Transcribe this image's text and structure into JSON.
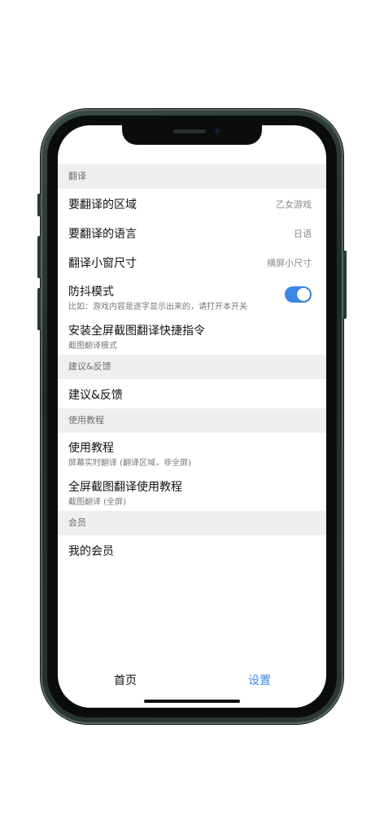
{
  "sections": {
    "translate": {
      "header": "翻译",
      "region": {
        "title": "要翻译的区域",
        "value": "乙女游戏"
      },
      "language": {
        "title": "要翻译的语言",
        "value": "日语"
      },
      "window_size": {
        "title": "翻译小窗尺寸",
        "value": "横屏小尺寸"
      },
      "anti_shake": {
        "title": "防抖模式",
        "subtitle": "比如：游戏内容是逐字显示出来的，请打开本开关",
        "enabled": true
      },
      "shortcut": {
        "title": "安装全屏截图翻译快捷指令",
        "subtitle": "截图翻译模式"
      }
    },
    "feedback": {
      "header": "建议&反馈",
      "item": {
        "title": "建议&反馈"
      }
    },
    "tutorial": {
      "header": "使用教程",
      "usage": {
        "title": "使用教程",
        "subtitle": "屏幕实时翻译 (翻译区域，非全屏)"
      },
      "fullscreen": {
        "title": "全屏截图翻译使用教程",
        "subtitle": "截图翻译 (全屏)"
      }
    },
    "member": {
      "header": "会员",
      "item": {
        "title": "我的会员"
      }
    }
  },
  "tabbar": {
    "home": "首页",
    "settings": "设置",
    "active": "settings"
  },
  "colors": {
    "accent": "#3b86e8",
    "section_bg": "#efefef",
    "frame": "#2b3a34"
  },
  "icons": {
    "toggle": "toggle-switch-icon"
  }
}
